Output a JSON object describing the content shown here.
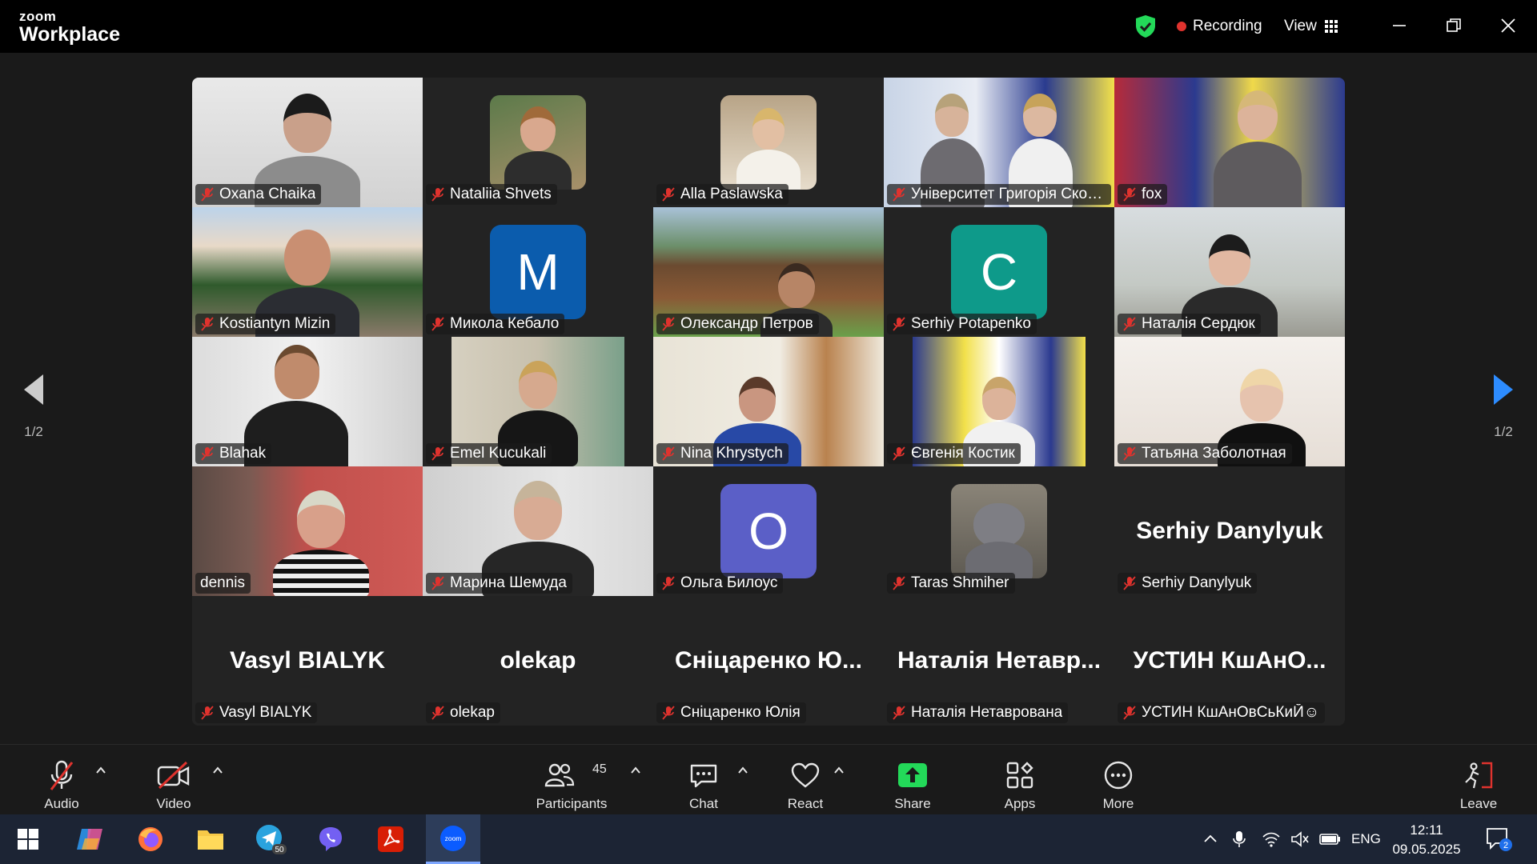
{
  "titlebar": {
    "brand_small": "zoom",
    "brand_big": "Workplace",
    "recording_label": "Recording",
    "view_label": "View",
    "accent_green": "#23d959"
  },
  "pager": {
    "left": "1/2",
    "right": "1/2"
  },
  "tiles": [
    {
      "name": "Oxana Chaika",
      "muted": true
    },
    {
      "name": "Nataliia Shvets",
      "muted": true
    },
    {
      "name": "Alla Paslawska",
      "muted": true
    },
    {
      "name": "Університет Григорія Сковоро...",
      "muted": true
    },
    {
      "name": "fox",
      "muted": true
    },
    {
      "name": "Kostiantyn Mizin",
      "muted": true
    },
    {
      "name": "Микола Кебало",
      "muted": true,
      "avatar_letter": "M",
      "avatar_color": "#0b5cad"
    },
    {
      "name": "Олександр Петров",
      "muted": true
    },
    {
      "name": "Serhiy Potapenko",
      "muted": true,
      "avatar_letter": "C",
      "avatar_color": "#0e9a8a"
    },
    {
      "name": "Наталія Сердюк",
      "muted": true
    },
    {
      "name": "Blahak",
      "muted": true
    },
    {
      "name": "Emel Kucukali",
      "muted": true
    },
    {
      "name": "Nina Khrystych",
      "muted": true
    },
    {
      "name": "Євгенія Костик",
      "muted": true
    },
    {
      "name": "Татьяна Заболотная",
      "muted": true
    },
    {
      "name": "dennis",
      "muted": false,
      "active_speaker": true
    },
    {
      "name": "Марина Шемуда",
      "muted": true
    },
    {
      "name": "Ольга Билоус",
      "muted": true,
      "avatar_letter": "O",
      "avatar_color": "#5b5fc7"
    },
    {
      "name": "Taras Shmiher",
      "muted": true
    },
    {
      "name": "Serhiy Danylyuk",
      "muted": true,
      "big_name": "Serhiy Danylyuk"
    },
    {
      "name": "Vasyl BIALYK",
      "muted": true,
      "big_name": "Vasyl BIALYK"
    },
    {
      "name": "olekap",
      "muted": true,
      "big_name": "olekap"
    },
    {
      "name": "Сніцаренко Юлія",
      "muted": true,
      "big_name": "Сніцаренко  Ю..."
    },
    {
      "name": "Наталія Нетаврована",
      "muted": true,
      "big_name": "Наталія  Нетавр..."
    },
    {
      "name": "УСТИН КшАнОвСьКиЙ☺",
      "muted": true,
      "big_name": "УСТИН  КшАнО..."
    }
  ],
  "toolbar": {
    "audio": "Audio",
    "video": "Video",
    "participants": "Participants",
    "participants_count": "45",
    "chat": "Chat",
    "react": "React",
    "share": "Share",
    "apps": "Apps",
    "more": "More",
    "leave": "Leave",
    "share_color": "#23d959",
    "muted_color": "#e0332e"
  },
  "taskbar": {
    "telegram_badge": "50",
    "zoom_label": "zoom",
    "lang": "ENG",
    "time": "12:11",
    "date": "09.05.2025",
    "notifications": "2"
  }
}
